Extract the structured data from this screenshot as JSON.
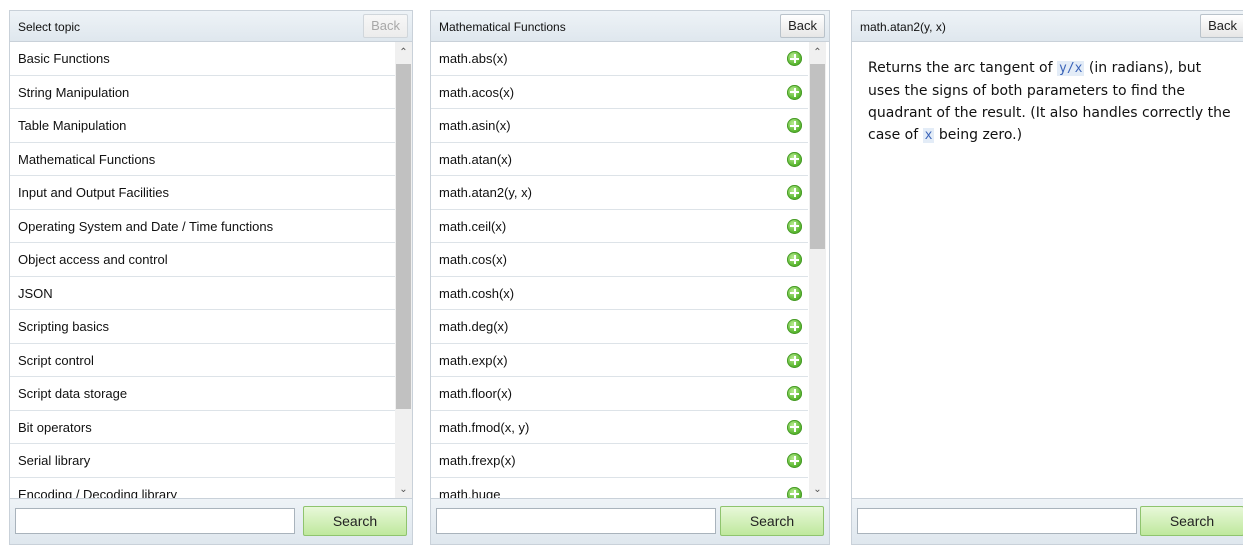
{
  "panel_topics": {
    "title": "Select topic",
    "back_label": "Back",
    "items": [
      "Basic Functions",
      "String Manipulation",
      "Table Manipulation",
      "Mathematical Functions",
      "Input and Output Facilities",
      "Operating System and Date / Time functions",
      "Object access and control",
      "JSON",
      "Scripting basics",
      "Script control",
      "Script data storage",
      "Bit operators",
      "Serial library",
      "Encoding / Decoding library"
    ],
    "search_value": "",
    "search_label": "Search"
  },
  "panel_functions": {
    "title": "Mathematical Functions",
    "back_label": "Back",
    "items": [
      "math.abs(x)",
      "math.acos(x)",
      "math.asin(x)",
      "math.atan(x)",
      "math.atan2(y, x)",
      "math.ceil(x)",
      "math.cos(x)",
      "math.cosh(x)",
      "math.deg(x)",
      "math.exp(x)",
      "math.floor(x)",
      "math.fmod(x, y)",
      "math.frexp(x)",
      "math.huge"
    ],
    "search_value": "",
    "search_label": "Search"
  },
  "panel_detail": {
    "title": "math.atan2(y, x)",
    "back_label": "Back",
    "desc_1": "Returns the arc tangent of ",
    "code_1": "y/x",
    "desc_2": " (in radians), but uses the signs of both parameters to find the quadrant of the result. (It also handles correctly the case of ",
    "code_2": "x",
    "desc_3": " being zero.)",
    "search_value": "",
    "search_label": "Search"
  },
  "colors": {
    "header_bg": "#dfe7ee",
    "search_button": "#bfe89d",
    "plus_icon": "#5cb832",
    "code_text": "#3a63b8"
  }
}
